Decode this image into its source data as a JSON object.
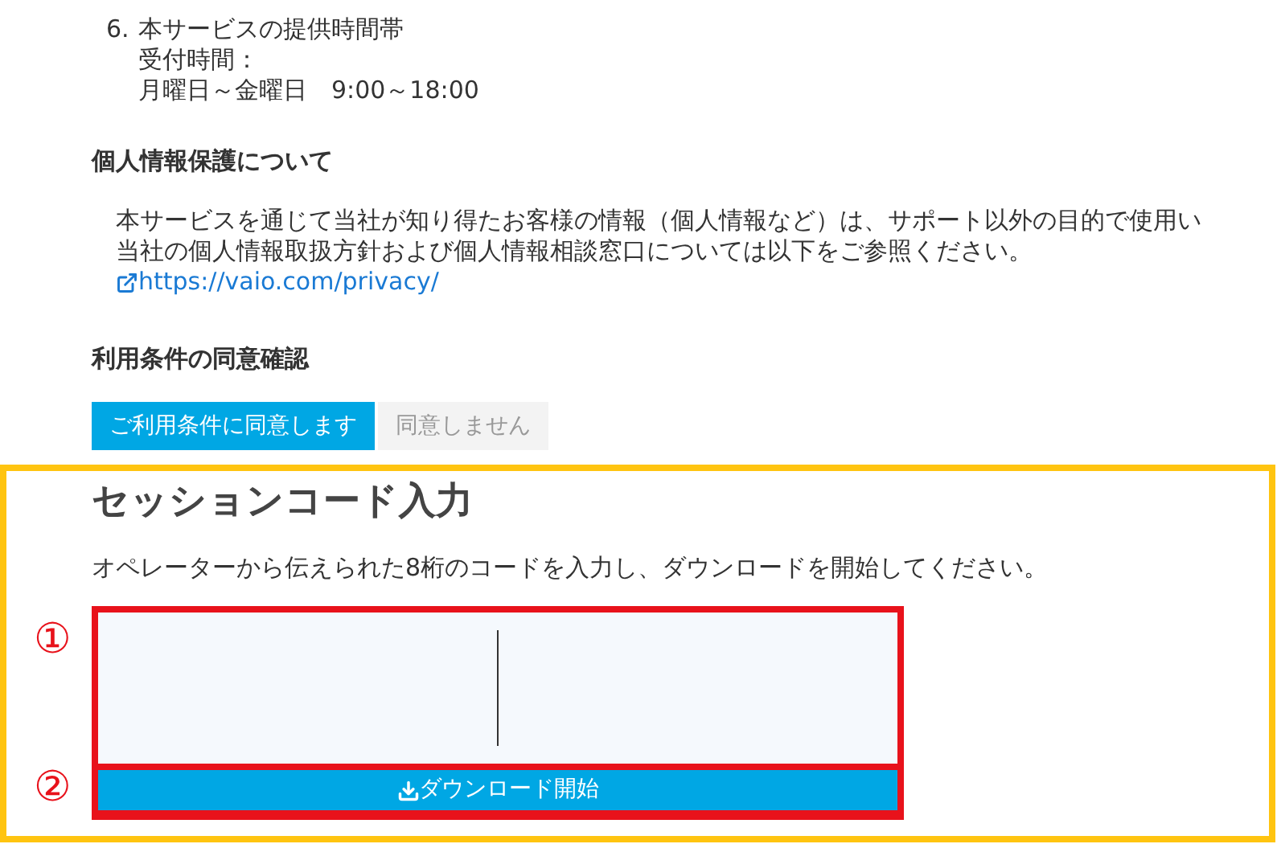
{
  "service_hours": {
    "number": "6.",
    "title": "本サービスの提供時間帯",
    "label": "受付時間：",
    "hours": "月曜日～金曜日　9:00～18:00"
  },
  "privacy": {
    "heading": "個人情報保護について",
    "lines": [
      "本サービスを通じて当社が知り得たお客様の情報（個人情報など）は、サポート以外の目的で使用い",
      "当社の個人情報取扱方針および個人情報相談窓口については以下をご参照ください。"
    ],
    "link": "https://vaio.com/privacy/"
  },
  "consent": {
    "heading": "利用条件の同意確認",
    "buttons": [
      {
        "label": "ご利用条件に同意します",
        "selected": true
      },
      {
        "label": "同意しません",
        "selected": false
      }
    ]
  },
  "session": {
    "title": "セッションコード入力",
    "description": "オペレーターから伝えられた8桁のコードを入力し、ダウンロードを開始してください。",
    "markers": [
      "①",
      "②"
    ],
    "download_button": "ダウンロード開始"
  }
}
